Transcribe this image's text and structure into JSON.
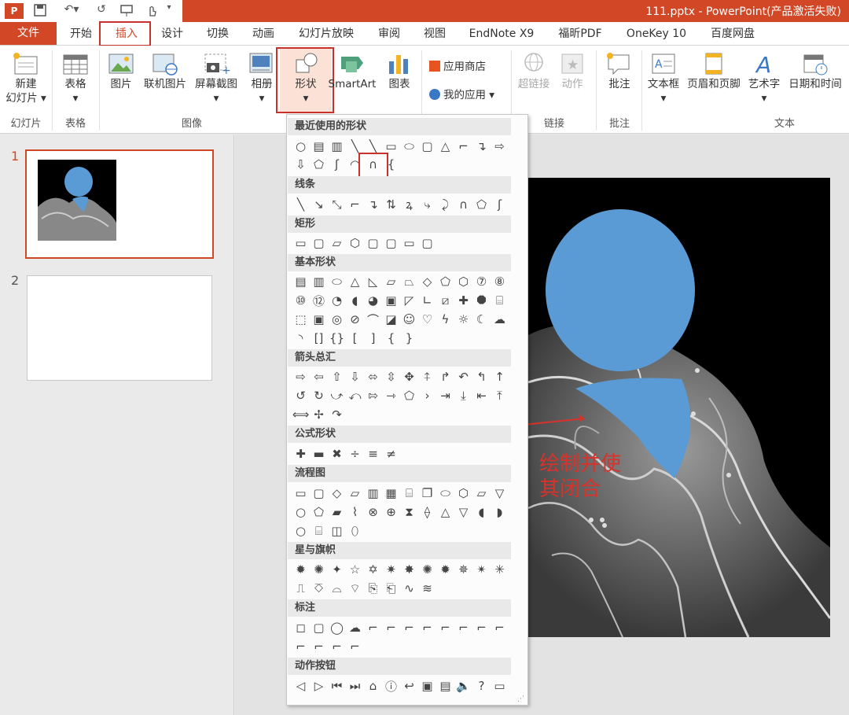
{
  "window": {
    "title": "111.pptx - PowerPoint(产品激活失败)"
  },
  "quick_access": {
    "undo": "↶",
    "redo": "↺"
  },
  "tabs": [
    {
      "label": "文件",
      "selected": false
    },
    {
      "label": "开始"
    },
    {
      "label": "插入",
      "selected": true
    },
    {
      "label": "设计"
    },
    {
      "label": "切换"
    },
    {
      "label": "动画"
    },
    {
      "label": "幻灯片放映"
    },
    {
      "label": "审阅"
    },
    {
      "label": "视图"
    },
    {
      "label": "EndNote X9"
    },
    {
      "label": "福昕PDF"
    },
    {
      "label": "OneKey 10"
    },
    {
      "label": "百度网盘"
    }
  ],
  "ribbon": {
    "new_slide_1": "新建",
    "new_slide_2": "幻灯片 ▾",
    "table": "表格",
    "picture": "图片",
    "online_picture": "联机图片",
    "screenshot": "屏幕截图",
    "album": "相册",
    "shapes": "形状",
    "smartart": "SmartArt",
    "chart": "图表",
    "app_store": "应用商店",
    "my_apps": "我的应用",
    "hyperlink": "超链接",
    "action": "动作",
    "comment": "批注",
    "textbox": "文本框",
    "header_footer": "页眉和页脚",
    "wordart": "艺术字",
    "datetime": "日期和时间",
    "groups": {
      "slides": "幻灯片",
      "tables": "表格",
      "images": "图像",
      "links": "链接",
      "comments": "批注",
      "text": "文本"
    }
  },
  "slides": [
    {
      "number": "1"
    },
    {
      "number": "2"
    }
  ],
  "annotation": {
    "line1": "绘制并使",
    "line2": "其闭合",
    "color": "#d9322a"
  },
  "shape_menu": {
    "sections": [
      "最近使用的形状",
      "线条",
      "矩形",
      "基本形状",
      "箭头总汇",
      "公式形状",
      "流程图",
      "星与旗帜",
      "标注",
      "动作按钮"
    ]
  },
  "colors": {
    "accent": "#d24726",
    "shape_fill": "#5b9bd5",
    "highlight": "#c8322a"
  }
}
